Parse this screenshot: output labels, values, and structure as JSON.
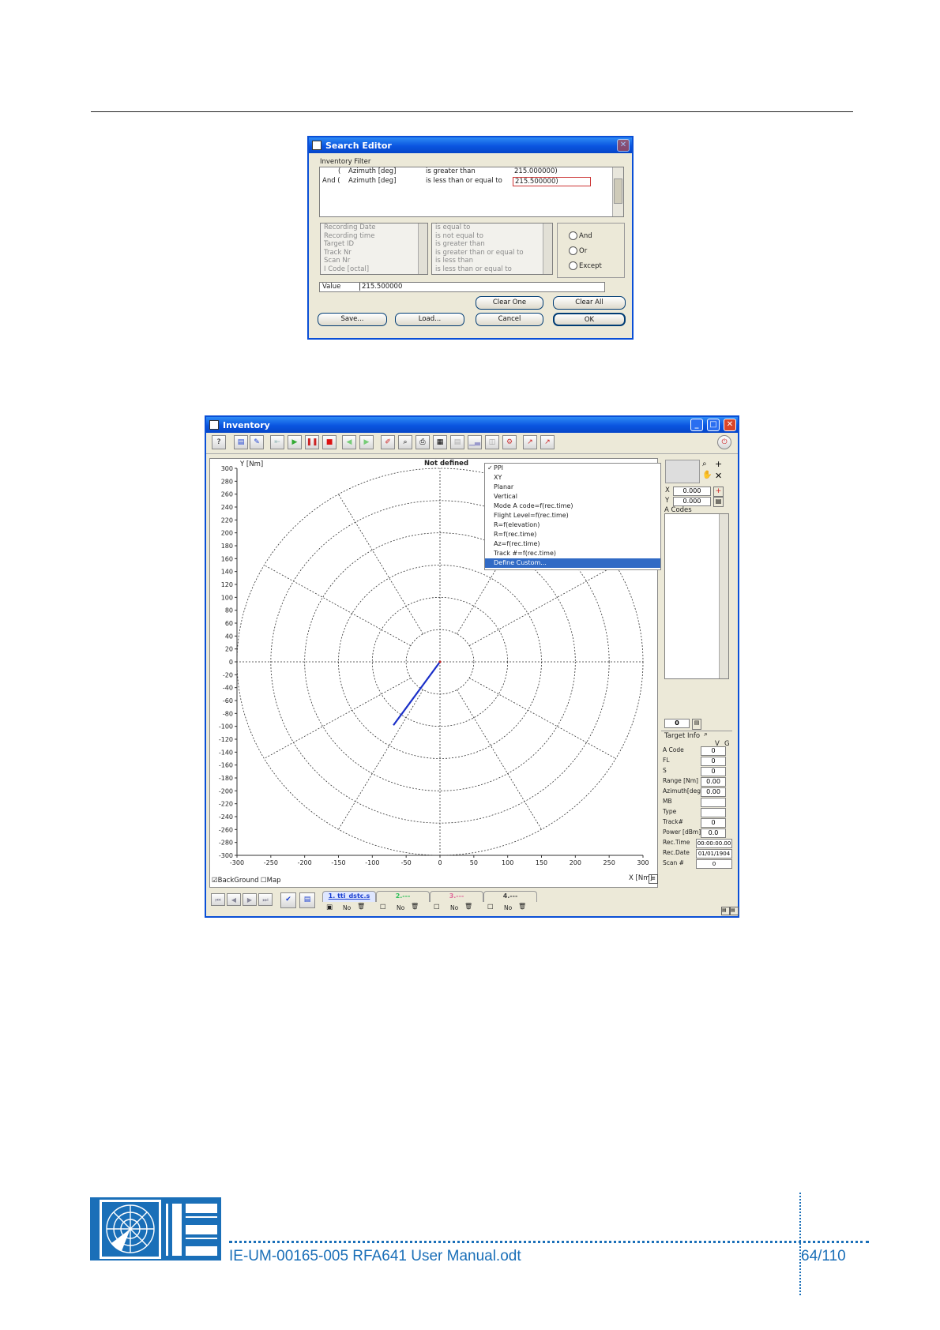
{
  "search_editor": {
    "title": "Search Editor",
    "group_label": "Inventory Filter",
    "filter_rows": [
      {
        "logic": "(",
        "field": "Azimuth [deg]",
        "op": "is greater than",
        "value": "215.000000)"
      },
      {
        "logic": "And (",
        "field": "Azimuth [deg]",
        "op": "is less than or equal to",
        "value": "215.500000)"
      }
    ],
    "fields": [
      "Recording Date",
      "Recording time",
      "Target ID",
      "Track Nr",
      "Scan Nr",
      "I Code [octal]"
    ],
    "operators": [
      "is equal to",
      "is not equal to",
      "is greater than",
      "is greater than or equal to",
      "is less than",
      "is less than or equal to"
    ],
    "logic_options": [
      "And",
      "Or",
      "Except"
    ],
    "value_label": "Value",
    "value": "215.500000",
    "buttons": {
      "clear_one": "Clear One",
      "clear_all": "Clear All",
      "save": "Save...",
      "load": "Load...",
      "cancel": "Cancel",
      "ok": "OK"
    }
  },
  "inventory": {
    "title": "Inventory",
    "plot_header": "Not defined",
    "y_axis_label": "Y [Nm]",
    "x_axis_label": "X [Nm]",
    "y_ticks": [
      "300",
      "280",
      "260",
      "240",
      "220",
      "200",
      "180",
      "160",
      "140",
      "120",
      "100",
      "80",
      "60",
      "40",
      "20",
      "0",
      "-20",
      "-40",
      "-60",
      "-80",
      "-100",
      "-120",
      "-140",
      "-160",
      "-180",
      "-200",
      "-220",
      "-240",
      "-260",
      "-280",
      "-300"
    ],
    "x_ticks": [
      "-300",
      "-250",
      "-200",
      "-150",
      "-100",
      "-50",
      "0",
      "50",
      "100",
      "150",
      "200",
      "250",
      "300"
    ],
    "view_menu": [
      "PPI",
      "XY",
      "Planar",
      "Vertical",
      "Mode A code=f(rec.time)",
      "Flight Level=f(rec.time)",
      "R=f(elevation)",
      "R=f(rec.time)",
      "Az=f(rec.time)",
      "Track #=f(rec.time)",
      "Define Custom..."
    ],
    "view_menu_checked": "PPI",
    "view_menu_selected": "Define Custom...",
    "checks": {
      "background": "BackGround",
      "map": "Map"
    },
    "files": [
      {
        "label": "1. tti_dstc.s",
        "color": "#1a3fd0",
        "flag": "No"
      },
      {
        "label": "2.---",
        "color": "#2fbf5a",
        "flag": "No"
      },
      {
        "label": "3.---",
        "color": "#e06a9a",
        "flag": "No"
      },
      {
        "label": "4.---",
        "color": "#444444",
        "flag": "No"
      }
    ],
    "right_panel": {
      "x_label": "X",
      "x_value": "0.000",
      "y_label": "Y",
      "y_value": "0.000",
      "a_codes_label": "A Codes",
      "count": "0",
      "target_info_label": "Target Info",
      "v_label": "V",
      "g_label": "G",
      "rows": [
        {
          "label": "A Code",
          "value": "0"
        },
        {
          "label": "FL",
          "value": "0"
        },
        {
          "label": "S",
          "value": "0"
        },
        {
          "label": "Range [Nm]",
          "value": "0.00"
        },
        {
          "label": "Azimuth[deg]",
          "value": "0.00"
        },
        {
          "label": "MB",
          "value": ""
        },
        {
          "label": "Type",
          "value": ""
        },
        {
          "label": "Track#",
          "value": "0"
        },
        {
          "label": "Power [dBm]",
          "value": "0.0"
        },
        {
          "label": "Rec.Time",
          "value": "00:00:00.00"
        },
        {
          "label": "Rec.Date",
          "value": "01/01/1904"
        },
        {
          "label": "Scan #",
          "value": "0"
        }
      ]
    },
    "colors": {
      "trace": "#1a2fc8",
      "title_bar": "#0a55e0"
    }
  },
  "footer": {
    "document": "IE-UM-00165-005 RFA641 User Manual.odt",
    "page": "64/110"
  }
}
